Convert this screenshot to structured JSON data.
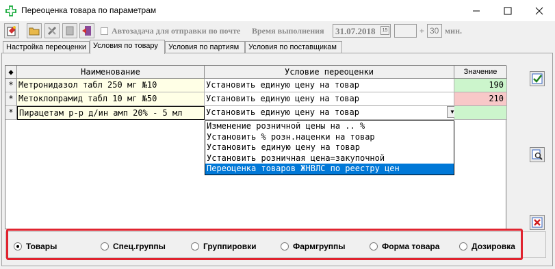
{
  "window": {
    "title": "Переоценка товара по параметрам",
    "minimize_glyph": "—",
    "maximize_glyph": "☐",
    "close_glyph": "✕"
  },
  "toolbar": {
    "auto_task_label": "Автозадача для отправки по почте",
    "exec_time_label": "Время выполнения",
    "date_value": "31.07.2018",
    "calendar_glyph": "15",
    "hours_value": "",
    "plus_label": "+",
    "minutes_value": "30",
    "minutes_label": "мин."
  },
  "tabs": [
    {
      "label": "Настройка переоценки",
      "active": false
    },
    {
      "label": "Условия по товару",
      "active": true
    },
    {
      "label": "Условия по партиям",
      "active": false
    },
    {
      "label": "Условия по поставщикам",
      "active": false
    }
  ],
  "grid": {
    "headers": [
      "Наименование",
      "Условие переоценки",
      "Значение"
    ],
    "rows": [
      {
        "mark": "*",
        "name": "Метронидазол табл 250 мг №10",
        "condition": "Установить единую цену на товар",
        "value": "190",
        "value_color": "#ccf5cc"
      },
      {
        "mark": "*",
        "name": "Метоклопрамид табл 10 мг №50",
        "condition": "Установить единую цену на товар",
        "value": "210",
        "value_color": "#f8c8c8"
      },
      {
        "mark": "*",
        "name": "Пирацетам р-р д/ин амп 20% - 5 мл",
        "condition": "Установить единую цену на товар",
        "value": "",
        "value_color": "#ccf5cc"
      }
    ],
    "dropdown_options": [
      "Изменение розничной цены на .. %",
      "Установить % розн.наценки на товар",
      "Установить единую цену на товар",
      "Установить розничная цена=закупочной",
      "Переоценка товаров ЖНВЛС по реестру цен"
    ],
    "dropdown_arrow": "▼"
  },
  "side_buttons": [
    {
      "icon": "check-icon"
    },
    {
      "icon": "search-icon"
    },
    {
      "icon": "delete-icon"
    }
  ],
  "radio_group": {
    "options": [
      {
        "label": "Товары",
        "checked": true
      },
      {
        "label": "Спец.группы",
        "checked": false
      },
      {
        "label": "Группировки",
        "checked": false
      },
      {
        "label": "Фармгруппы",
        "checked": false
      },
      {
        "label": "Форма товара",
        "checked": false
      },
      {
        "label": "Дозировка",
        "checked": false
      }
    ]
  },
  "colors": {
    "name_bg": "#ffffe6",
    "selection": "#0078d7",
    "highlight_border": "#e0232f"
  }
}
